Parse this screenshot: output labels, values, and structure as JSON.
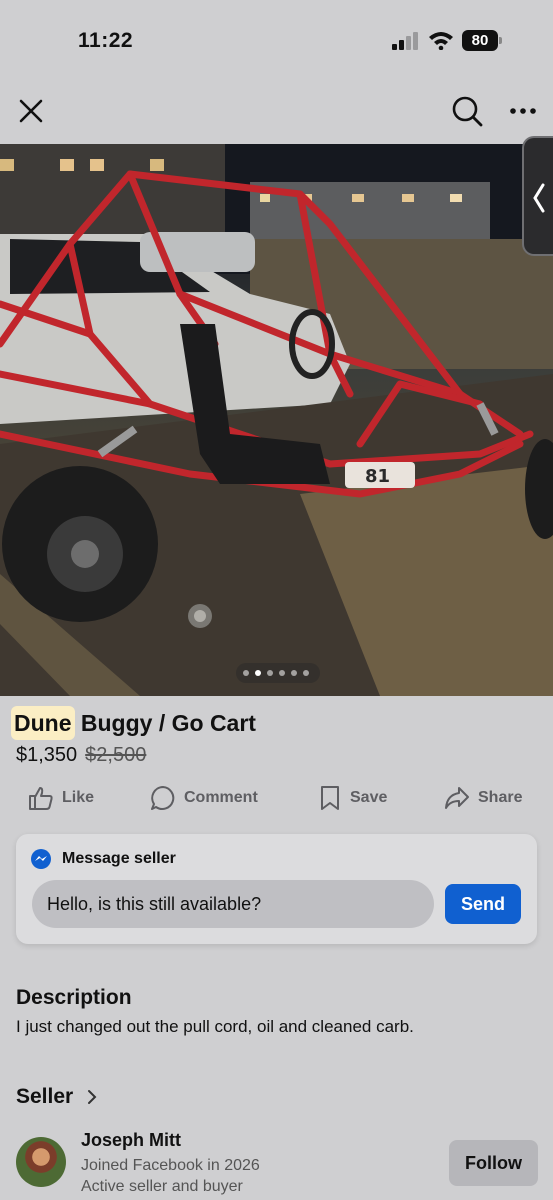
{
  "status_bar": {
    "time": "11:22",
    "battery": "80"
  },
  "listing": {
    "title_highlight": "Dune",
    "title_rest": " Buggy / Go Cart",
    "price": "$1,350",
    "original_price": "$2,500",
    "photo_count": 6,
    "photo_index": 1
  },
  "actions": [
    {
      "label": "Like",
      "icon": "like-icon"
    },
    {
      "label": "Comment",
      "icon": "comment-icon"
    },
    {
      "label": "Save",
      "icon": "bookmark-icon"
    },
    {
      "label": "Share",
      "icon": "share-icon"
    }
  ],
  "message": {
    "header": "Message seller",
    "input_value": "Hello, is this still available?",
    "send_label": "Send"
  },
  "description": {
    "title": "Description",
    "text": "I just changed out the pull cord, oil and cleaned carb."
  },
  "seller": {
    "section_title": "Seller",
    "name": "Joseph Mitt",
    "joined": "Joined Facebook in 2026",
    "status": "Active seller and buyer",
    "follow_label": "Follow"
  },
  "colors": {
    "accent": "#1060d0",
    "highlight": "#fbeec4",
    "background": "#cfcfd1"
  }
}
